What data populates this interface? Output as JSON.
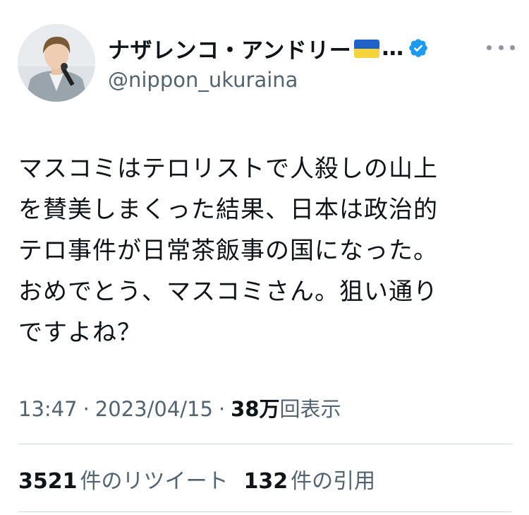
{
  "author": {
    "display_name": "ナザレンコ・アンドリー",
    "name_ellipsis": "…",
    "handle": "@nippon_ukuraina",
    "flag_icon": "ukraine-flag-icon",
    "verified_icon": "verified-badge-icon",
    "verified_color": "#1d9bf0"
  },
  "more_icon": "more-options-icon",
  "tweet": {
    "text": "マスコミはテロリストで人殺しの山上\nを賛美しまくった結果、日本は政治的\nテロ事件が日常茶飯事の国になった。\nおめでとう、マスコミさん。狙い通り\nですよね？"
  },
  "meta": {
    "time": "13:47",
    "separator": "·",
    "date": "2023/04/15",
    "views_count": "38万",
    "views_label": "回表示"
  },
  "stats": {
    "retweets_count": "3521",
    "retweets_label": "件のリツイート",
    "quotes_count": "132",
    "quotes_label": "件の引用"
  },
  "colors": {
    "text_primary": "#0f1419",
    "text_secondary": "#536471",
    "divider": "#cfd9de",
    "flag_blue": "#1f63c8",
    "flag_yellow": "#f6d33b"
  }
}
